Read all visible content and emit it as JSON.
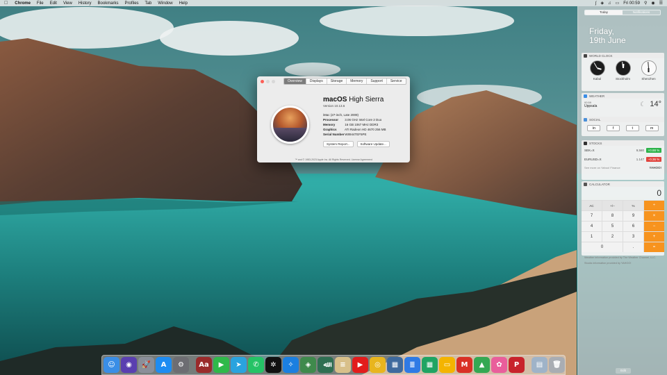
{
  "menubar": {
    "app_name": "Chrome",
    "items": [
      "File",
      "Edit",
      "View",
      "History",
      "Bookmarks",
      "Profiles",
      "Tab",
      "Window",
      "Help"
    ],
    "clock": "Fri 00:59"
  },
  "about_window": {
    "tabs": [
      "Overview",
      "Displays",
      "Storage",
      "Memory",
      "Support",
      "Service"
    ],
    "active_tab": "Overview",
    "os_name_prefix": "macOS",
    "os_name_suffix": "High Sierra",
    "version": "Version 10.13.6",
    "model": "iMac (27-inch, Late 2009)",
    "specs": [
      {
        "key": "Processor",
        "value": "3.06 GHz Intel Core 2 Duo"
      },
      {
        "key": "Memory",
        "value": "16 GB 1067 MHz DDR3"
      },
      {
        "key": "Graphics",
        "value": "ATI Radeon HD 4670 256 MB"
      },
      {
        "key": "Serial Number",
        "value": "W8944TEF5PE"
      }
    ],
    "buttons": {
      "system_report": "System Report...",
      "software_update": "Software Update..."
    },
    "legal": "™ and © 1983-2023 Apple Inc. All Rights Reserved. License Agreement"
  },
  "notification_center": {
    "tabs": [
      "Today",
      "Notifications"
    ],
    "active_tab": "Today",
    "date_line1": "Friday,",
    "date_line2": "19th June",
    "world_clock": {
      "title": "WORLD CLOCK",
      "clocks": [
        {
          "city": "Kabul",
          "theme": "dark",
          "hour_deg": 105,
          "min_deg": 330
        },
        {
          "city": "Stockholm",
          "theme": "dark",
          "hour_deg": 5,
          "min_deg": 355
        },
        {
          "city": "Shenzhen",
          "theme": "light",
          "hour_deg": 180,
          "min_deg": 355
        }
      ]
    },
    "weather": {
      "title": "WEATHER",
      "time": "00:59",
      "city": "Uppsala",
      "temp": "14°"
    },
    "social": {
      "title": "SOCIAL",
      "buttons": [
        "in",
        "f",
        "t",
        "m"
      ]
    },
    "stocks": {
      "title": "STOCKS",
      "rows": [
        {
          "symbol": "SEK=X",
          "price": "9,580",
          "change": "+0.88 %",
          "color": "#2db34a"
        },
        {
          "symbol": "EURUSD=X",
          "price": "1.147",
          "change": "−0.36 %",
          "color": "#e0443e"
        }
      ],
      "footer": "See more on Yahoo! Finance",
      "brand": "YAHOO!"
    },
    "calculator": {
      "title": "CALCULATOR",
      "display": "0",
      "keys": [
        {
          "label": "AC",
          "kind": "fn"
        },
        {
          "label": "+/−",
          "kind": "fn"
        },
        {
          "label": "%",
          "kind": "fn"
        },
        {
          "label": "÷",
          "kind": "op"
        },
        {
          "label": "7",
          "kind": "num"
        },
        {
          "label": "8",
          "kind": "num"
        },
        {
          "label": "9",
          "kind": "num"
        },
        {
          "label": "×",
          "kind": "op"
        },
        {
          "label": "4",
          "kind": "num"
        },
        {
          "label": "5",
          "kind": "num"
        },
        {
          "label": "6",
          "kind": "num"
        },
        {
          "label": "−",
          "kind": "op"
        },
        {
          "label": "1",
          "kind": "num"
        },
        {
          "label": "2",
          "kind": "num"
        },
        {
          "label": "3",
          "kind": "num"
        },
        {
          "label": "+",
          "kind": "op"
        },
        {
          "label": "0",
          "kind": "zero"
        },
        {
          "label": ".",
          "kind": "num"
        },
        {
          "label": "=",
          "kind": "op"
        }
      ]
    },
    "weather_credit": "Weather information provided by The Weather Channel, LLC.",
    "stocks_credit": "Stocks information provided by YAHOO!",
    "edit_label": "Edit"
  },
  "dock": {
    "apps": [
      {
        "name": "finder-icon",
        "glyph": "☺",
        "color": "#3a8ee6"
      },
      {
        "name": "siri-icon",
        "glyph": "◉",
        "color": "#5a3fb0"
      },
      {
        "name": "launchpad-icon",
        "glyph": "🚀",
        "color": "#8a8f99"
      },
      {
        "name": "app-store-icon",
        "glyph": "A",
        "color": "#1d8cf2"
      },
      {
        "name": "system-preferences-icon",
        "glyph": "⚙",
        "color": "#6d6d72"
      },
      {
        "sep": true
      },
      {
        "name": "dictionary-icon",
        "glyph": "Aa",
        "color": "#9a2b2b"
      },
      {
        "name": "facetime-icon",
        "glyph": "▶",
        "color": "#2fb94a"
      },
      {
        "name": "telegram-icon",
        "glyph": "➤",
        "color": "#2aa3de"
      },
      {
        "name": "whatsapp-icon",
        "glyph": "✆",
        "color": "#25c366"
      },
      {
        "name": "chatgpt-icon",
        "glyph": "✲",
        "color": "#111111"
      },
      {
        "name": "safari-icon",
        "glyph": "✧",
        "color": "#1b7fe0"
      },
      {
        "name": "quran-icon",
        "glyph": "◈",
        "color": "#3f8a4c"
      },
      {
        "name": "arabic-app-icon",
        "glyph": "ﷲ",
        "color": "#2f6f52"
      },
      {
        "name": "notes-icon",
        "glyph": "≡",
        "color": "#d8c08a"
      },
      {
        "name": "youtube-icon",
        "glyph": "▶",
        "color": "#e21c1c"
      },
      {
        "name": "chrome-icon",
        "glyph": "◎",
        "color": "#e8b51e"
      },
      {
        "name": "archive-utility-icon",
        "glyph": "▦",
        "color": "#3e6a9e"
      },
      {
        "name": "google-docs-icon",
        "glyph": "≣",
        "color": "#2f7ae5"
      },
      {
        "name": "google-sheets-icon",
        "glyph": "▦",
        "color": "#1fa463"
      },
      {
        "name": "google-slides-icon",
        "glyph": "▭",
        "color": "#f4b400"
      },
      {
        "name": "gmail-icon",
        "glyph": "M",
        "color": "#d93025"
      },
      {
        "name": "google-drive-icon",
        "glyph": "▲",
        "color": "#34a853"
      },
      {
        "name": "photos-icon",
        "glyph": "✿",
        "color": "#e95e9b"
      },
      {
        "name": "pinterest-icon",
        "glyph": "P",
        "color": "#c8232c"
      },
      {
        "sep": true
      },
      {
        "name": "document-icon",
        "glyph": "▤",
        "color": "#9fb3c8"
      },
      {
        "name": "trash-icon",
        "glyph": "🗑",
        "color": "#a9adb3"
      }
    ]
  }
}
